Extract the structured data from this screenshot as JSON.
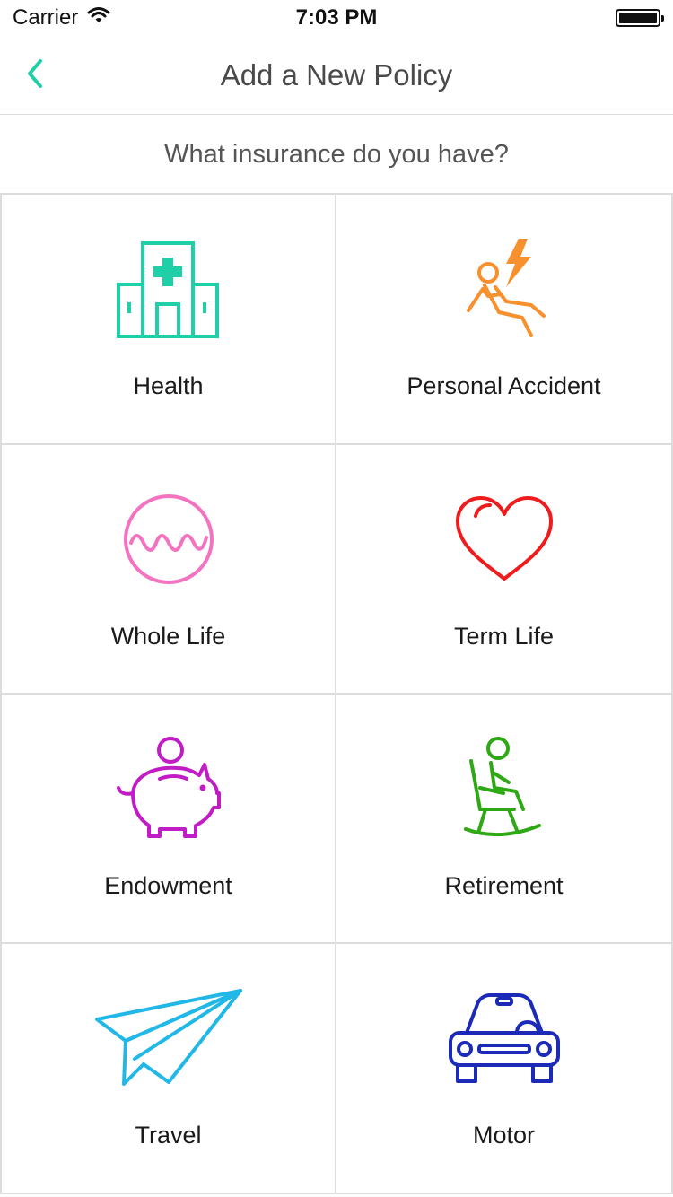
{
  "status_bar": {
    "carrier": "Carrier",
    "time": "7:03 PM"
  },
  "nav": {
    "title": "Add a New Policy",
    "back_icon": "chevron-left-icon"
  },
  "prompt": "What insurance do you have?",
  "policies": [
    {
      "label": "Health",
      "icon": "hospital-icon",
      "color": "#1ecfa7"
    },
    {
      "label": "Personal Accident",
      "icon": "accident-icon",
      "color": "#f7902d"
    },
    {
      "label": "Whole Life",
      "icon": "pulse-circle-icon",
      "color": "#f473c1"
    },
    {
      "label": "Term Life",
      "icon": "heart-icon",
      "color": "#ee1c1c"
    },
    {
      "label": "Endowment",
      "icon": "piggy-bank-icon",
      "color": "#c11cc6"
    },
    {
      "label": "Retirement",
      "icon": "rocking-chair-icon",
      "color": "#2fa815"
    },
    {
      "label": "Travel",
      "icon": "paper-plane-icon",
      "color": "#21b8e8"
    },
    {
      "label": "Motor",
      "icon": "car-icon",
      "color": "#1c2ab8"
    }
  ],
  "colors": {
    "accent": "#1ecfa7",
    "divider": "#dcdcdc"
  }
}
